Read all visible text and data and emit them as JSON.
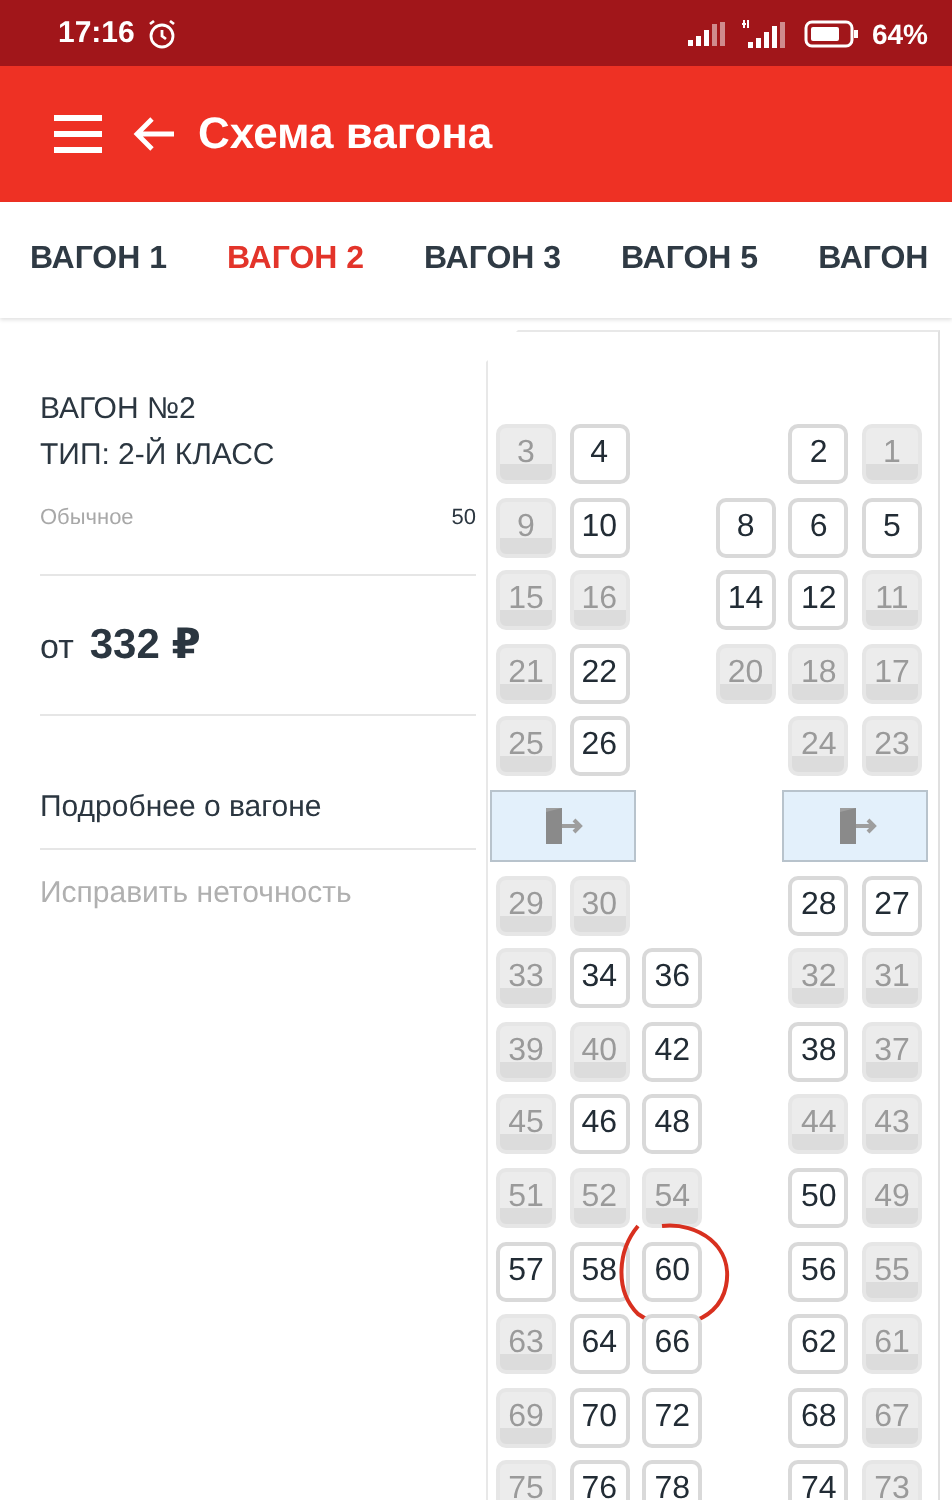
{
  "status_bar": {
    "time": "17:16",
    "battery": "64%"
  },
  "app_bar": {
    "title": "Схема вагона"
  },
  "tabs": [
    {
      "label": "ВАГОН 1",
      "selected": false
    },
    {
      "label": "ВАГОН 2",
      "selected": true
    },
    {
      "label": "ВАГОН 3",
      "selected": false
    },
    {
      "label": "ВАГОН 5",
      "selected": false
    },
    {
      "label": "ВАГОН",
      "selected": false
    }
  ],
  "car_info": {
    "title": "ВАГОН №2",
    "type": "ТИП: 2-Й КЛАСС",
    "seat_type": "Обычное",
    "seat_count": "50",
    "price_prefix": "от",
    "price": "332 ₽",
    "details_link": "Подробнее о вагоне",
    "report_link": "Исправить неточность"
  },
  "seat_rows": [
    {
      "kind": "seats",
      "cells": [
        {
          "number": "3",
          "available": false
        },
        {
          "number": "4",
          "available": true
        },
        null,
        null,
        {
          "number": "2",
          "available": true
        },
        {
          "number": "1",
          "available": false
        }
      ]
    },
    {
      "kind": "seats",
      "cells": [
        {
          "number": "9",
          "available": false
        },
        {
          "number": "10",
          "available": true
        },
        null,
        {
          "number": "8",
          "available": true
        },
        {
          "number": "6",
          "available": true
        },
        {
          "number": "5",
          "available": true
        }
      ]
    },
    {
      "kind": "seats",
      "cells": [
        {
          "number": "15",
          "available": false
        },
        {
          "number": "16",
          "available": false
        },
        null,
        {
          "number": "14",
          "available": true
        },
        {
          "number": "12",
          "available": true
        },
        {
          "number": "11",
          "available": false
        }
      ]
    },
    {
      "kind": "seats",
      "cells": [
        {
          "number": "21",
          "available": false
        },
        {
          "number": "22",
          "available": true
        },
        null,
        {
          "number": "20",
          "available": false
        },
        {
          "number": "18",
          "available": false
        },
        {
          "number": "17",
          "available": false
        }
      ]
    },
    {
      "kind": "seats",
      "cells": [
        {
          "number": "25",
          "available": false
        },
        {
          "number": "26",
          "available": true
        },
        null,
        null,
        {
          "number": "24",
          "available": false
        },
        {
          "number": "23",
          "available": false
        }
      ]
    },
    {
      "kind": "doors"
    },
    {
      "kind": "seats",
      "cells": [
        {
          "number": "29",
          "available": false
        },
        {
          "number": "30",
          "available": false
        },
        null,
        null,
        {
          "number": "28",
          "available": true
        },
        {
          "number": "27",
          "available": true
        }
      ]
    },
    {
      "kind": "seats",
      "cells": [
        {
          "number": "33",
          "available": false
        },
        {
          "number": "34",
          "available": true
        },
        {
          "number": "36",
          "available": true
        },
        null,
        {
          "number": "32",
          "available": false
        },
        {
          "number": "31",
          "available": false
        }
      ]
    },
    {
      "kind": "seats",
      "cells": [
        {
          "number": "39",
          "available": false
        },
        {
          "number": "40",
          "available": false
        },
        {
          "number": "42",
          "available": true
        },
        null,
        {
          "number": "38",
          "available": true
        },
        {
          "number": "37",
          "available": false
        }
      ]
    },
    {
      "kind": "seats",
      "cells": [
        {
          "number": "45",
          "available": false
        },
        {
          "number": "46",
          "available": true
        },
        {
          "number": "48",
          "available": true
        },
        null,
        {
          "number": "44",
          "available": false
        },
        {
          "number": "43",
          "available": false
        }
      ]
    },
    {
      "kind": "seats",
      "cells": [
        {
          "number": "51",
          "available": false
        },
        {
          "number": "52",
          "available": false
        },
        {
          "number": "54",
          "available": false
        },
        null,
        {
          "number": "50",
          "available": true
        },
        {
          "number": "49",
          "available": false
        }
      ]
    },
    {
      "kind": "seats",
      "cells": [
        {
          "number": "57",
          "available": true
        },
        {
          "number": "58",
          "available": true
        },
        {
          "number": "60",
          "available": true,
          "circled": true
        },
        null,
        {
          "number": "56",
          "available": true
        },
        {
          "number": "55",
          "available": false
        }
      ]
    },
    {
      "kind": "seats",
      "cells": [
        {
          "number": "63",
          "available": false
        },
        {
          "number": "64",
          "available": true
        },
        {
          "number": "66",
          "available": true
        },
        null,
        {
          "number": "62",
          "available": true
        },
        {
          "number": "61",
          "available": false
        }
      ]
    },
    {
      "kind": "seats",
      "cells": [
        {
          "number": "69",
          "available": false
        },
        {
          "number": "70",
          "available": true
        },
        {
          "number": "72",
          "available": true
        },
        null,
        {
          "number": "68",
          "available": true
        },
        {
          "number": "67",
          "available": false
        }
      ]
    },
    {
      "kind": "seats",
      "cells": [
        {
          "number": "75",
          "available": false
        },
        {
          "number": "76",
          "available": true
        },
        {
          "number": "78",
          "available": true
        },
        null,
        {
          "number": "74",
          "available": true
        },
        {
          "number": "73",
          "available": false
        }
      ]
    }
  ]
}
